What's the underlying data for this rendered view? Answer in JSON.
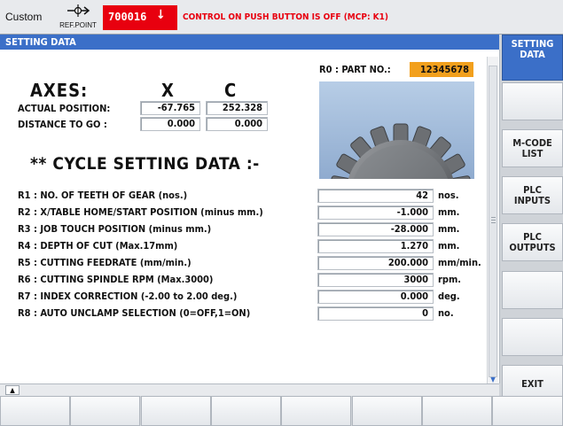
{
  "status_bar": {
    "mode": "Custom",
    "refpoint_label": "REF.POINT",
    "alarm_number": "700016",
    "alarm_arrow": "↓",
    "alarm_message": "CONTROL ON PUSH BUTTON IS OFF (MCP: K1)",
    "alarm_color": "#e8000f"
  },
  "title": "SETTING DATA",
  "part": {
    "label": "R0 : PART NO.:",
    "value": "12345678",
    "highlight_color": "#f2a01d"
  },
  "axes": {
    "title": "AXES:",
    "columns": [
      "X",
      "C"
    ],
    "rows": [
      {
        "label": "ACTUAL POSITION:",
        "values": [
          "-67.765",
          "252.328"
        ]
      },
      {
        "label": "DISTANCE TO GO :",
        "values": [
          "0.000",
          "0.000"
        ]
      }
    ]
  },
  "cycle_title": "** CYCLE SETTING DATA :-",
  "params": [
    {
      "label": "R1 : NO. OF TEETH OF GEAR (nos.)",
      "value": "42",
      "unit": "nos."
    },
    {
      "label": "R2 : X/TABLE HOME/START POSITION (minus mm.)",
      "value": "-1.000",
      "unit": "mm."
    },
    {
      "label": "R3 : JOB TOUCH POSITION (minus mm.)",
      "value": "-28.000",
      "unit": "mm."
    },
    {
      "label": "R4 : DEPTH OF CUT (Max.17mm)",
      "value": "1.270",
      "unit": "mm."
    },
    {
      "label": "R5 : CUTTING FEEDRATE (mm/min.)",
      "value": "200.000",
      "unit": "mm/min."
    },
    {
      "label": "R6 : CUTTING SPINDLE RPM (Max.3000)",
      "value": "3000",
      "unit": "rpm."
    },
    {
      "label": "R7 : INDEX CORRECTION (-2.00 to 2.00 deg.)",
      "value": "0.000",
      "unit": "deg."
    },
    {
      "label": "R8 : AUTO UNCLAMP SELECTION (0=OFF,1=ON)",
      "value": "0",
      "unit": "no."
    }
  ],
  "softkeys_vertical": [
    "SETTING\nDATA",
    "",
    "M-CODE\nLIST",
    "PLC\nINPUTS",
    "PLC\nOUTPUTS",
    "",
    "",
    "EXIT"
  ],
  "softkeys_horizontal": [
    "",
    "",
    "",
    "",
    "",
    "",
    "",
    ""
  ],
  "icons": {
    "refpoint": "reference-point-icon",
    "gear": "gear-image",
    "collapse": "chevron-up-icon",
    "scroll_down": "chevron-down-icon"
  },
  "accent_color": "#3b6fc8"
}
